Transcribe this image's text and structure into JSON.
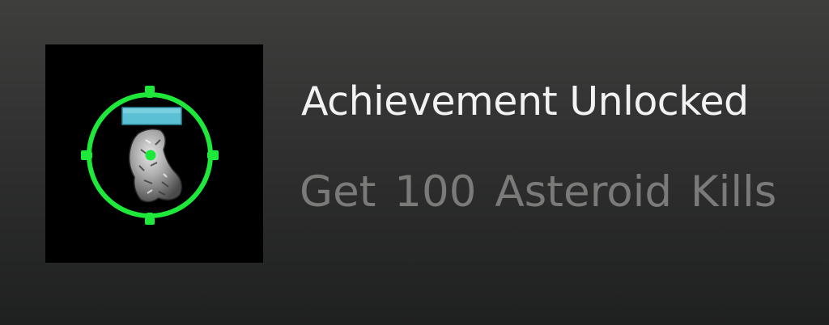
{
  "achievement": {
    "title": "Achievement Unlocked",
    "description": "Get 100 Asteroid Kills",
    "icon": "asteroid-target-icon"
  },
  "colors": {
    "background_top": "#3e3f3d",
    "background_bottom": "#1f2020",
    "title_text": "#f2f2f2",
    "description_text": "#7a7a78",
    "reticle_green": "#1ee83a",
    "health_bar": "#5bc0d4"
  }
}
